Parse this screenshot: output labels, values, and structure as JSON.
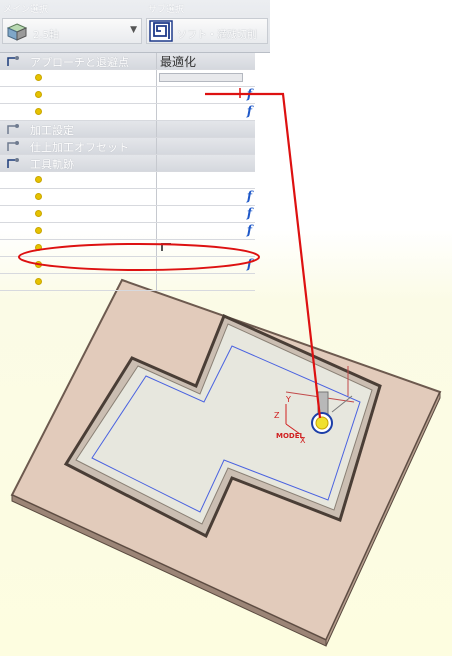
{
  "top": {
    "main_header": "メイン選択",
    "sub_header": "サブ選択",
    "main_value": "2.5軸",
    "sub_value": "ソフト・満残切削"
  },
  "params": {
    "rows": [
      {
        "kind": "section",
        "label": "アプローチと退避点",
        "value": "最適化",
        "f": false,
        "input": false
      },
      {
        "kind": "item",
        "label": "",
        "value": "",
        "f": false,
        "input": true
      },
      {
        "kind": "item",
        "label": "",
        "value": "",
        "f": true,
        "input": false
      },
      {
        "kind": "item",
        "label": "",
        "value": "",
        "f": true,
        "input": false
      },
      {
        "kind": "section",
        "label": "加工設定",
        "value": "",
        "f": false,
        "input": false
      },
      {
        "kind": "section",
        "label": "仕上加工オフセット",
        "value": "",
        "f": false,
        "input": false
      },
      {
        "kind": "section",
        "label": "工具軌跡",
        "value": "",
        "f": false,
        "input": false
      },
      {
        "kind": "item",
        "label": "",
        "value": "",
        "f": false,
        "input": false
      },
      {
        "kind": "item",
        "label": "",
        "value": "",
        "f": true,
        "input": false
      },
      {
        "kind": "item",
        "label": "",
        "value": "",
        "f": true,
        "input": false
      },
      {
        "kind": "item",
        "label": "",
        "value": "",
        "f": true,
        "input": false
      },
      {
        "kind": "item",
        "label": "",
        "value": "",
        "f": false,
        "input": false,
        "corner": true
      },
      {
        "kind": "item",
        "label": "",
        "value": "",
        "f": true,
        "input": false
      },
      {
        "kind": "item",
        "label": "",
        "value": "",
        "f": false,
        "input": false
      }
    ]
  },
  "model": {
    "axis_y": "Y",
    "axis_z": "Z",
    "axis_x": "X",
    "model_label": "MODEL"
  },
  "colors": {
    "plate_fill": "#e2cbbb",
    "pocket_fill": "#e7e7de",
    "toolpath": "#4a62e0",
    "annotation": "#dd1111",
    "f_icon": "#1e58c8",
    "dot": "#e6c200"
  },
  "icons": {
    "main": "cube-icon",
    "sub": "spiral-pocket-icon",
    "tree": "tree-node-icon",
    "formula": "function-icon"
  }
}
